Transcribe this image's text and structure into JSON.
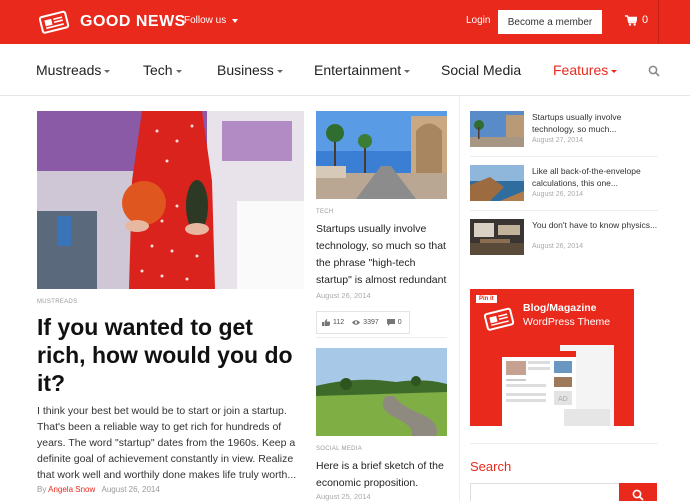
{
  "brand": {
    "name": "GOOD NEWS",
    "accent": "#e8291c"
  },
  "topbar": {
    "follow_label": "Follow us",
    "login_label": "Login",
    "member_label": "Become a member",
    "cart_count": "0"
  },
  "nav": {
    "items": [
      {
        "label": "Mustreads"
      },
      {
        "label": "Tech"
      },
      {
        "label": "Business"
      },
      {
        "label": "Entertainment"
      },
      {
        "label": "Social Media"
      },
      {
        "label": "Features"
      }
    ]
  },
  "main_article": {
    "category": "MUSTREADS",
    "title": "If you wanted to get rich, how would you do it?",
    "excerpt": "I think your best bet would be to start or join a startup. That's been a reliable way to get rich for hundreds of years. The word \"startup\" dates from the 1960s. Keep a definite goal of achievement constantly in view. Realize that work well and worthily done makes life truly worth...",
    "by_label": "By",
    "author": "Angela Snow",
    "date": "August 26, 2014"
  },
  "mid_articles": [
    {
      "category": "TECH",
      "title": "Startups usually involve technology, so much so that the phrase \"high-tech startup\" is almost redundant",
      "date": "August 26, 2014",
      "likes": "112",
      "views": "3397",
      "comments": "0"
    },
    {
      "category": "SOCIAL MEDIA",
      "title": "Here is a brief sketch of the economic proposition.",
      "date": "August 25, 2014"
    }
  ],
  "side_articles": [
    {
      "title": "Startups usually involve technology, so much...",
      "date": "August 27, 2014"
    },
    {
      "title": "Like all back-of-the-envelope calculations, this one...",
      "date": "August 26, 2014"
    },
    {
      "title": "You don't have to know physics...",
      "date": "August 26, 2014"
    }
  ],
  "ad": {
    "badge": "Pin it",
    "title": "Blog/Magazine",
    "subtitle": "WordPress Theme",
    "mock_label": "AD"
  },
  "search": {
    "title": "Search",
    "placeholder": ""
  }
}
